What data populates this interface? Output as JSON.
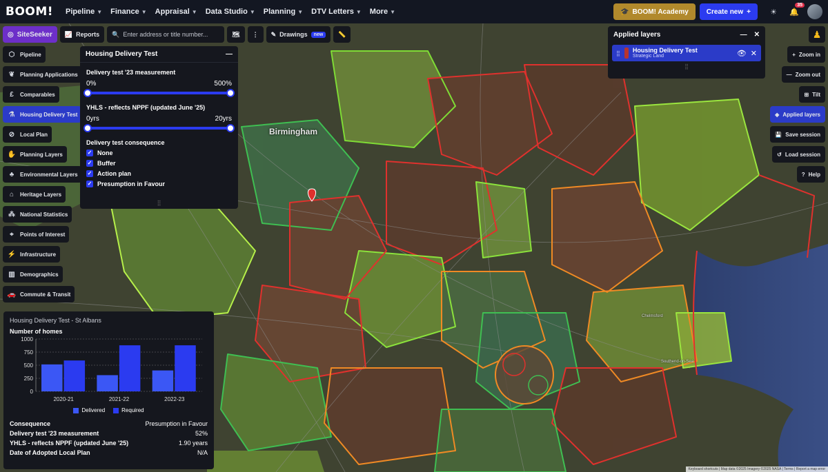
{
  "nav": {
    "logo": "BOOM!",
    "items": [
      "Pipeline",
      "Finance",
      "Appraisal",
      "Data Studio",
      "Planning",
      "DTV Letters",
      "More"
    ],
    "academy": "BOOM! Academy",
    "create_new": "Create new",
    "notifications": "35"
  },
  "toolbar": {
    "siteseeker": "SiteSeeker",
    "reports": "Reports",
    "search_placeholder": "Enter address or title number...",
    "drawings": "Drawings",
    "new_tag": "new"
  },
  "sidebar": {
    "items": [
      {
        "label": "Pipeline",
        "icon": "pipeline-icon"
      },
      {
        "label": "Planning Applications",
        "icon": "leaf-icon"
      },
      {
        "label": "Comparables",
        "icon": "pound-icon"
      },
      {
        "label": "Housing Delivery Test",
        "icon": "flask-icon"
      },
      {
        "label": "Local Plan",
        "icon": "no-entry-icon"
      },
      {
        "label": "Planning Layers",
        "icon": "hand-icon"
      },
      {
        "label": "Environmental Layers",
        "icon": "tree-icon"
      },
      {
        "label": "Heritage Layers",
        "icon": "building-icon"
      },
      {
        "label": "National Statistics",
        "icon": "network-icon"
      },
      {
        "label": "Points of Interest",
        "icon": "poi-icon"
      },
      {
        "label": "Infrastructure",
        "icon": "pylon-icon"
      },
      {
        "label": "Demographics",
        "icon": "chart-icon"
      },
      {
        "label": "Commute & Transit",
        "icon": "car-icon"
      }
    ],
    "active_index": 3
  },
  "hdt_panel": {
    "title": "Housing Delivery Test",
    "slider1": {
      "label": "Delivery test '23 measurement",
      "min": "0%",
      "max": "500%"
    },
    "slider2": {
      "label": "YHLS - reflects NPPF (updated June '25)",
      "min": "0yrs",
      "max": "20yrs"
    },
    "consequence_label": "Delivery test consequence",
    "options": [
      "None",
      "Buffer",
      "Action plan",
      "Presumption in Favour"
    ]
  },
  "chart_panel": {
    "title": "Housing Delivery Test - St Albans",
    "subtitle": "Number of homes",
    "stats": [
      {
        "k": "Consequence",
        "v": "Presumption in Favour"
      },
      {
        "k": "Delivery test '23 measurement",
        "v": "52%"
      },
      {
        "k": "YHLS - reflects NPPF (updated June '25)",
        "v": "1.90 years"
      },
      {
        "k": "Date of Adopted Local Plan",
        "v": "N/A"
      }
    ]
  },
  "chart_data": {
    "type": "bar",
    "categories": [
      "2020-21",
      "2021-22",
      "2022-23"
    ],
    "series": [
      {
        "name": "Delivered",
        "values": [
          515,
          310,
          400
        ],
        "color": "#3b57f5"
      },
      {
        "name": "Required",
        "values": [
          590,
          880,
          880
        ],
        "color": "#2b3bf0"
      }
    ],
    "ylim": [
      0,
      1000
    ],
    "yticks": [
      0,
      250,
      500,
      750,
      1000
    ],
    "legend": "bottom"
  },
  "applied": {
    "title": "Applied layers",
    "layer_name": "Housing Delivery Test",
    "layer_sub": "Strategic Land"
  },
  "right_controls": {
    "zoom_in": "Zoom in",
    "zoom_out": "Zoom out",
    "tilt": "Tilt",
    "applied_layers": "Applied layers",
    "save_session": "Save session",
    "load_session": "Load session",
    "help": "Help"
  },
  "map": {
    "cities": [
      "Birmingham",
      "Chelmsford",
      "Southend-on-Sea"
    ],
    "attribution": "Keyboard shortcuts | Map data ©2025 Imagery ©2025 NASA | Terms | Report a map error"
  }
}
